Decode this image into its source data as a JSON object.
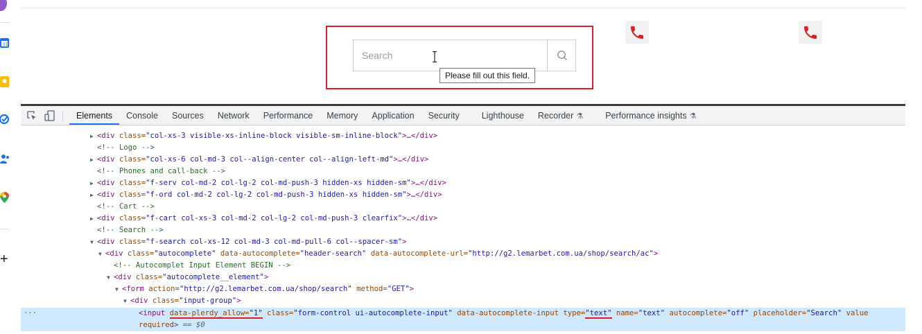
{
  "colors": {
    "highlight": "#d61f26",
    "phone": "#d61f26",
    "accent": "#1a73e8"
  },
  "search": {
    "placeholder": "Search",
    "tooltip": "Please fill out this field."
  },
  "rail": {
    "icons": [
      "calendar-icon",
      "keep-icon",
      "tasks-icon",
      "contacts-icon",
      "maps-icon"
    ],
    "add": "+"
  },
  "devtools": {
    "tabs": [
      "Elements",
      "Console",
      "Sources",
      "Network",
      "Performance",
      "Memory",
      "Application",
      "Security",
      "Lighthouse",
      "Recorder",
      "Performance insights"
    ],
    "active_tab": "Elements",
    "lines": [
      {
        "c1": "<div ",
        "a1": "class=",
        "v1": "\"col-xs-3 visible-xs-inline-block visible-sm-inline-block\"",
        "e1": ">…</div>"
      },
      {
        "cmt": "<!-- Logo -->"
      },
      {
        "c1": "<div ",
        "a1": "class=",
        "v1": "\"col-xs-6 col-md-3 col--align-center col--align-left-md\"",
        "e1": ">…</div>"
      },
      {
        "cmt": "<!-- Phones and call-back -->"
      },
      {
        "c1": "<div ",
        "a1": "class=",
        "v1": "\"f-serv col-md-2 col-lg-2 col-md-push-3 hidden-xs hidden-sm\"",
        "e1": ">…</div>"
      },
      {
        "c1": "<div ",
        "a1": "class=",
        "v1": "\"f-ord col-md-2 col-lg-2 col-md-push-3 hidden-xs hidden-sm\"",
        "e1": ">…</div>"
      },
      {
        "cmt": "<!-- Cart -->"
      },
      {
        "c1": "<div ",
        "a1": "class=",
        "v1": "\"f-cart col-xs-3 col-md-2 col-lg-2 col-md-push-3 clearfix\"",
        "e1": ">…</div>"
      },
      {
        "cmt": "<!-- Search -->"
      },
      {
        "c1": "<div ",
        "a1": "class=",
        "v1": "\"f-search col-xs-12 col-md-3 col-md-pull-6 col--spacer-sm\"",
        "e1": ">"
      },
      {
        "c1": "<div ",
        "a1": "class=",
        "v1": "\"autocomplete\"",
        "a2": " data-autocomplete=",
        "v2": "\"header-search\"",
        "a3": " data-autocomplete-url=",
        "v3": "\"http://g2.lemarbet.com.ua/shop/search/ac\"",
        "e1": ">"
      },
      {
        "cmt": "<!-- Autocomplet Input Element BEGIN -->"
      },
      {
        "c1": "<div ",
        "a1": "class=",
        "v1": "\"autocomplete__element\"",
        "e1": ">"
      },
      {
        "c1": "<form ",
        "a1": "action=",
        "v1": "\"http://g2.lemarbet.com.ua/shop/search\"",
        "a2": " method=",
        "v2": "\"GET\"",
        "e1": ">"
      },
      {
        "c1": "<div ",
        "a1": "class=",
        "v1": "\"input-group\"",
        "e1": ">"
      },
      {
        "c1": "<input ",
        "a1": "data-plerdy_allow=",
        "v1": "\"1\"",
        "a2": " class=",
        "v2": "\"form-control ui-autocomplete-input\"",
        "a3": " data-autocomplete-input type=",
        "v3": "\"text\"",
        "a4": " name=",
        "v4": "\"text\"",
        "a5": " autocomplete=",
        "v5": "\"off\"",
        "a6": " placeholder=",
        "v6": "\"Search\"",
        "a7": " value",
        "e1": ""
      },
      {
        "c1": "required",
        "e1": ">",
        "dim": " == $0"
      }
    ],
    "selected_dots": "···"
  }
}
